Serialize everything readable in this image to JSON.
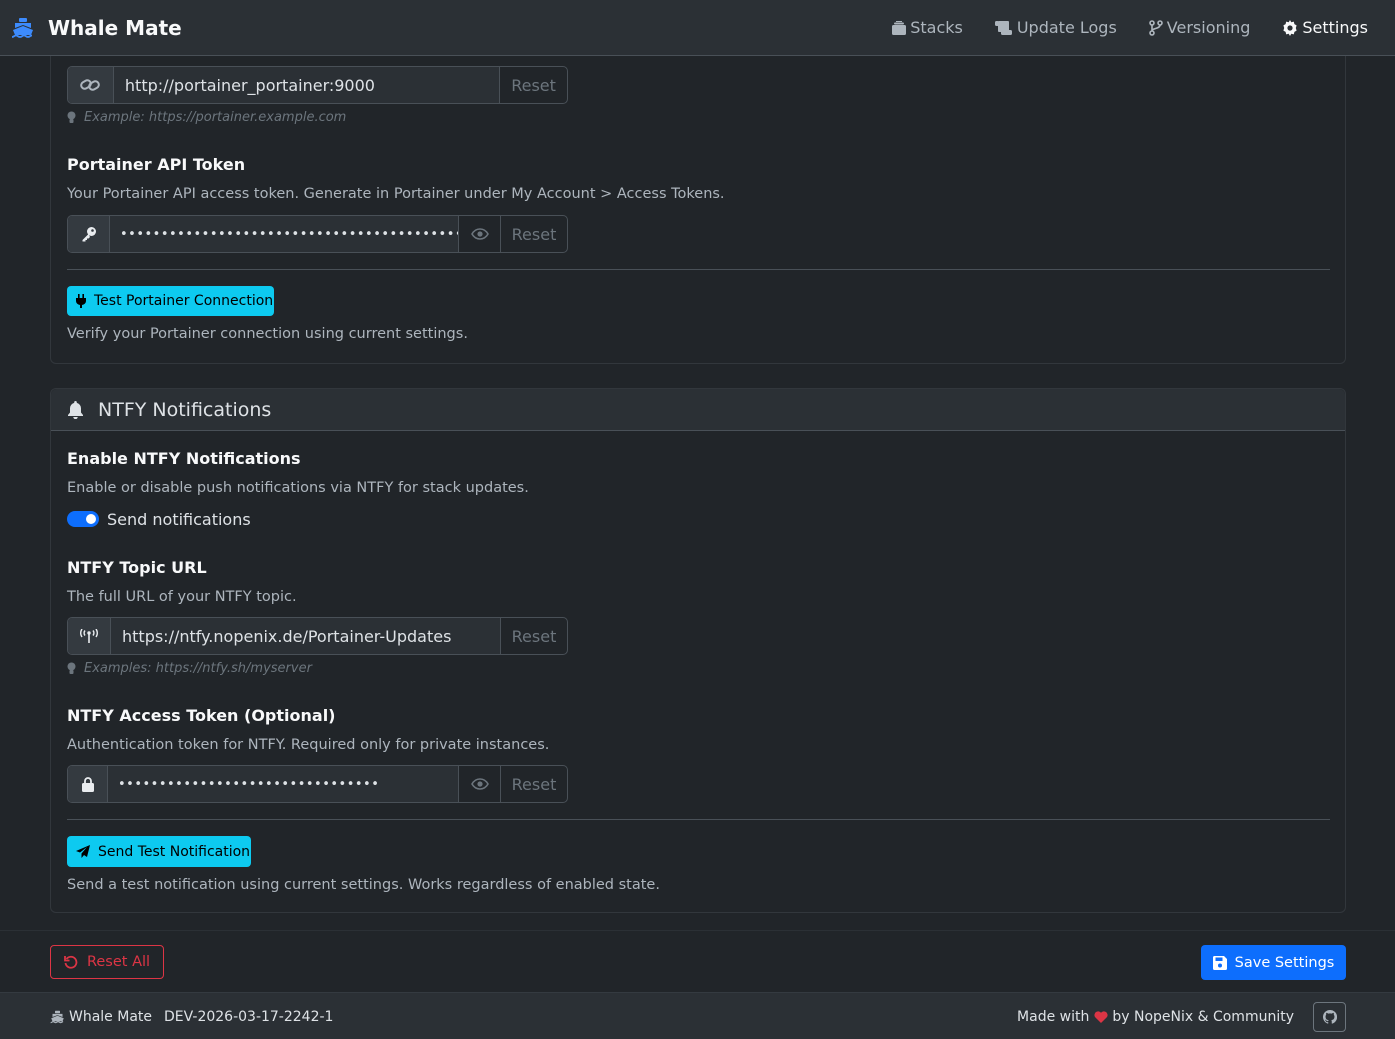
{
  "app": {
    "title": "Whale Mate",
    "brand_icon": "ship-icon"
  },
  "nav": {
    "items": [
      {
        "label": "Stacks",
        "icon": "layers-icon",
        "active": false
      },
      {
        "label": "Update Logs",
        "icon": "scroll-icon",
        "active": false
      },
      {
        "label": "Versioning",
        "icon": "code-branch-icon",
        "active": false
      },
      {
        "label": "Settings",
        "icon": "gear-icon",
        "active": true
      }
    ]
  },
  "portainer": {
    "url": {
      "value": "http://portainer_portainer:9000",
      "reset_label": "Reset",
      "hint": "Example: https://portainer.example.com",
      "icon": "link-icon"
    },
    "token": {
      "label": "Portainer API Token",
      "description": "Your Portainer API access token. Generate in Portainer under My Account > Access Tokens.",
      "masked_value": "••••••••••••••••••••••••••••••••••••••••••••••••",
      "reset_label": "Reset",
      "icon": "key-icon"
    },
    "test_button_label": "Test Portainer Connection",
    "test_description": "Verify your Portainer connection using current settings."
  },
  "ntfy": {
    "title": "NTFY Notifications",
    "enable": {
      "label": "Enable NTFY Notifications",
      "description": "Enable or disable push notifications via NTFY for stack updates.",
      "toggle_label": "Send notifications",
      "enabled": true
    },
    "topic": {
      "label": "NTFY Topic URL",
      "description": "The full URL of your NTFY topic.",
      "value": "https://ntfy.nopenix.de/Portainer-Updates",
      "reset_label": "Reset",
      "hint": "Examples: https://ntfy.sh/myserver",
      "icon": "broadcast-icon"
    },
    "token": {
      "label": "NTFY Access Token (Optional)",
      "description": "Authentication token for NTFY. Required only for private instances.",
      "masked_value": "••••••••••••••••••••••••••••••••",
      "reset_label": "Reset",
      "icon": "lock-icon"
    },
    "test_button_label": "Send Test Notification",
    "test_description": "Send a test notification using current settings. Works regardless of enabled state."
  },
  "actions": {
    "reset_all_label": "Reset All",
    "save_label": "Save Settings"
  },
  "footer": {
    "app_name": "Whale Mate",
    "version": "DEV-2026-03-17-2242-1",
    "made_with": "Made with",
    "by_text": "by NopeNix & Community"
  },
  "colors": {
    "accent": "#0d6efd",
    "info": "#0dcaf0",
    "danger": "#dc3545",
    "brand_icon": "#3d8bfd"
  }
}
